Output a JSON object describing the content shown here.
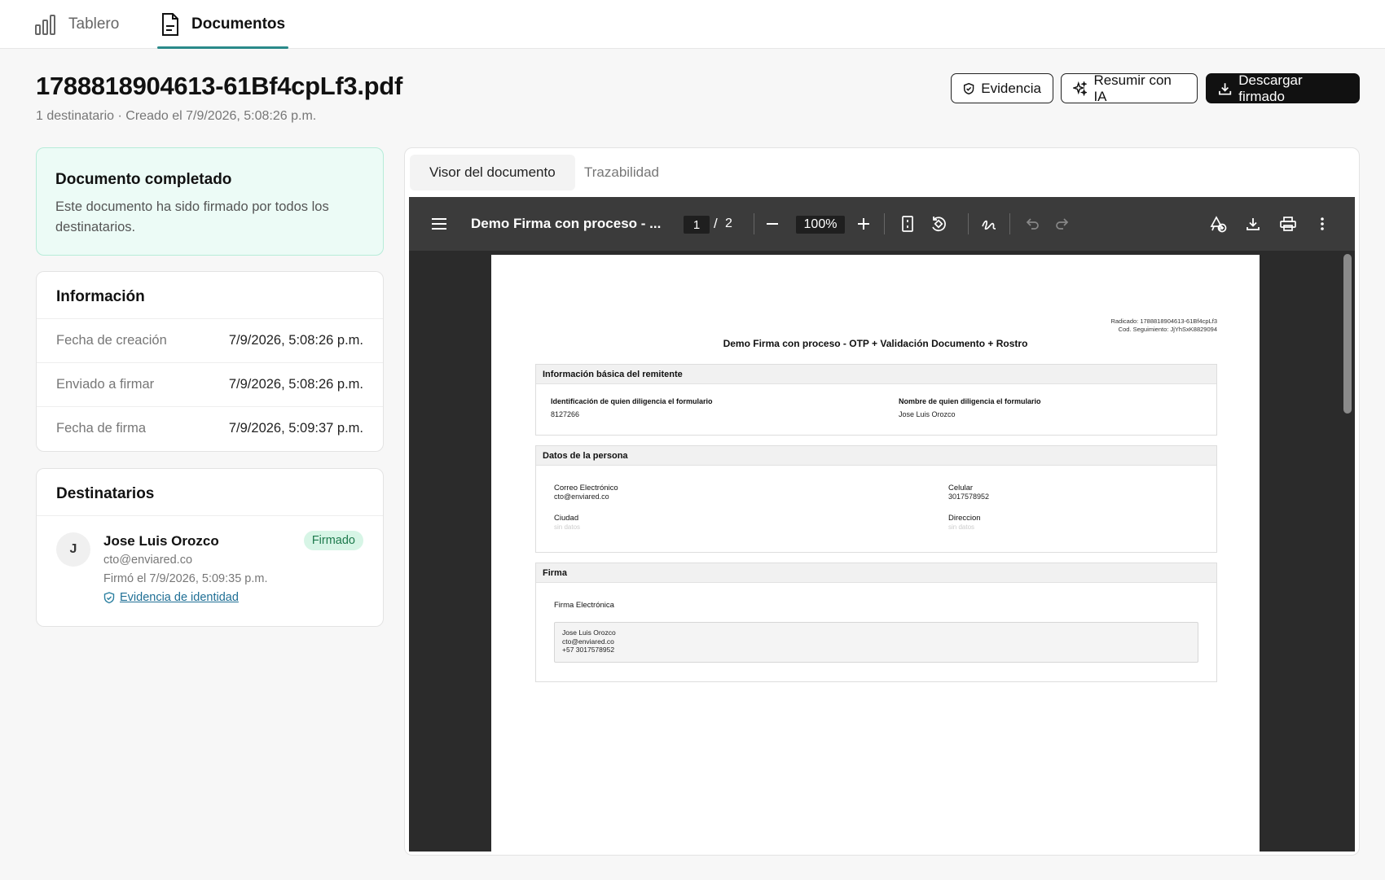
{
  "nav": {
    "tabs": [
      {
        "label": "Tablero",
        "icon": "bar-chart-icon"
      },
      {
        "label": "Documentos",
        "icon": "document-icon"
      }
    ]
  },
  "document": {
    "title": "1788818904613-61Bf4cpLf3.pdf",
    "subtitle": "1 destinatario · Creado el 7/9/2026, 5:08:26 p.m."
  },
  "actions": {
    "evidence": "Evidencia",
    "summarize": "Resumir con IA",
    "download": "Descargar firmado"
  },
  "status": {
    "title": "Documento completado",
    "message": "Este documento ha sido firmado por todos los destinatarios."
  },
  "info": {
    "title": "Información",
    "rows": [
      {
        "label": "Fecha de creación",
        "value": "7/9/2026, 5:08:26 p.m."
      },
      {
        "label": "Enviado a firmar",
        "value": "7/9/2026, 5:08:26 p.m."
      },
      {
        "label": "Fecha de firma",
        "value": "7/9/2026, 5:09:37 p.m."
      }
    ]
  },
  "recipients": {
    "title": "Destinatarios",
    "items": [
      {
        "initial": "J",
        "name": "Jose Luis Orozco",
        "email": "cto@enviared.co",
        "signed_at": "Firmó el 7/9/2026, 5:09:35 p.m.",
        "badge": "Firmado",
        "evidence_link": "Evidencia de identidad"
      }
    ]
  },
  "viewer": {
    "tabs": [
      "Visor del documento",
      "Trazabilidad"
    ],
    "toolbar": {
      "title": "Demo Firma con proceso - ...",
      "page_current": "1",
      "page_sep": "/",
      "page_total": "2",
      "zoom": "100%"
    },
    "pdf": {
      "radicado": "Radicado: 1788818904613-61Bf4cpLf3",
      "seguimiento": "Cod. Seguimiento: JjYhSxK8829094",
      "heading": "Demo Firma con proceso - OTP + Validación Documento + Rostro",
      "sec1": {
        "title": "Información básica del remitente",
        "id_label": "Identificación de quien diligencia el formulario",
        "id_value": "8127266",
        "name_label": "Nombre de quien diligencia el formulario",
        "name_value": "Jose Luis Orozco"
      },
      "sec2": {
        "title": "Datos de la persona",
        "email_label": "Correo Electrónico",
        "email_value": "cto@enviared.co",
        "phone_label": "Celular",
        "phone_value": "3017578952",
        "city_label": "Ciudad",
        "city_value": "sin datos",
        "address_label": "Direccion",
        "address_value": "sin datos"
      },
      "sec3": {
        "title": "Firma",
        "sig_label": "Firma Electrónica",
        "sig_line1": "Jose Luis Orozco",
        "sig_line2": "cto@enviared.co",
        "sig_line3": "+57 3017578952"
      }
    }
  },
  "colors": {
    "accent": "#2a8a8a",
    "success_bg": "#ecfbf6",
    "badge_bg": "#d7f5e6",
    "badge_text": "#1e7a4d"
  }
}
